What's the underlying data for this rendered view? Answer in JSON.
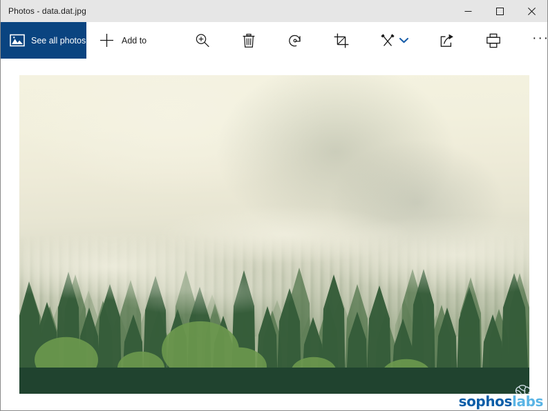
{
  "window": {
    "title": "Photos - data.dat.jpg",
    "app_name": "Photos",
    "file_name": "data.dat.jpg",
    "controls": {
      "minimize": "Minimize",
      "maximize": "Maximize",
      "close": "Close"
    }
  },
  "toolbar": {
    "see_all_photos": {
      "label": "See all photos",
      "icon": "photo-icon",
      "background": "#0a4480"
    },
    "add_to": {
      "label": "Add to",
      "icon": "plus-icon"
    },
    "actions": [
      {
        "name": "zoom",
        "label": "Zoom",
        "icon": "magnifier-plus-icon"
      },
      {
        "name": "delete",
        "label": "Delete",
        "icon": "trash-icon"
      },
      {
        "name": "rotate",
        "label": "Rotate",
        "icon": "rotate-icon"
      },
      {
        "name": "crop",
        "label": "Crop & rotate",
        "icon": "crop-icon"
      },
      {
        "name": "edit-create",
        "label": "Edit & create",
        "icon": "pen-brush-icon",
        "has_dropdown": true,
        "dropdown_icon": "chevron-down-icon"
      },
      {
        "name": "share",
        "label": "Share",
        "icon": "share-icon"
      },
      {
        "name": "print",
        "label": "Print",
        "icon": "printer-icon"
      },
      {
        "name": "more",
        "label": "See more",
        "icon": "ellipsis-icon",
        "glyph": "···"
      }
    ]
  },
  "photo": {
    "alt": "Misty coniferous forest with fog rolling over pine treetops",
    "subject": "forest",
    "dominant_colors": {
      "sky": "#f3f1df",
      "mist": "#e2e0cd",
      "foliage": "#4a7045",
      "ground_band": "#20432f"
    }
  },
  "watermark": {
    "brand_primary": "sophos",
    "brand_secondary": "labs",
    "primary_color": "#0c5ea8",
    "secondary_color": "#5ab4e5"
  },
  "colors": {
    "titlebar_bg": "#e6e6e6",
    "toolbar_bg": "#ffffff",
    "accent_blue": "#0a4480",
    "chevron_blue": "#1b5faa",
    "text": "#1a1a1a"
  }
}
